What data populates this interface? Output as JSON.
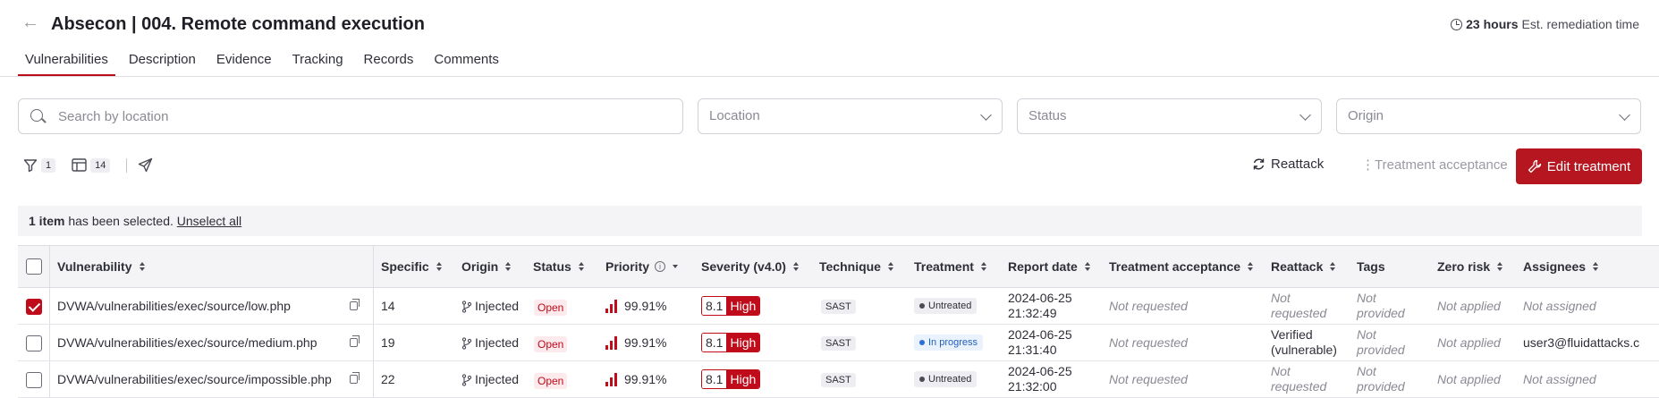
{
  "header": {
    "title": "Absecon | 004. Remote command execution",
    "remediation_hours": "23 hours",
    "remediation_label": "Est. remediation time"
  },
  "tabs": [
    "Vulnerabilities",
    "Description",
    "Evidence",
    "Tracking",
    "Records",
    "Comments"
  ],
  "filters": {
    "search_placeholder": "Search by location",
    "location": "Location",
    "status": "Status",
    "origin": "Origin"
  },
  "toolbar": {
    "filter_count": "1",
    "columns_count": "14",
    "reattack": "Reattack",
    "treatment_acceptance": "Treatment acceptance",
    "edit_treatment": "Edit treatment"
  },
  "selection": {
    "count": "1 item",
    "text": "has been selected.",
    "unselect": "Unselect all"
  },
  "columns": [
    "Vulnerability",
    "Specific",
    "Origin",
    "Status",
    "Priority",
    "Severity (v4.0)",
    "Technique",
    "Treatment",
    "Report date",
    "Treatment acceptance",
    "Reattack",
    "Tags",
    "Zero risk",
    "Assignees"
  ],
  "rows": [
    {
      "vulnerability": "DVWA/vulnerabilities/exec/source/low.php",
      "specific": "14",
      "origin": "Injected",
      "status": "Open",
      "priority": "99.91%",
      "severity_score": "8.1",
      "severity_level": "High",
      "technique": "SAST",
      "treatment": "Untreated",
      "report_date_line1": "2024-06-25",
      "report_date_line2": "21:32:49",
      "treatment_acceptance": "Not requested",
      "reattack_line1": "Not",
      "reattack_line2": "requested",
      "tags_line1": "Not",
      "tags_line2": "provided",
      "zero_risk": "Not applied",
      "assignees": "Not assigned",
      "selected": true
    },
    {
      "vulnerability": "DVWA/vulnerabilities/exec/source/medium.php",
      "specific": "19",
      "origin": "Injected",
      "status": "Open",
      "priority": "99.91%",
      "severity_score": "8.1",
      "severity_level": "High",
      "technique": "SAST",
      "treatment": "In progress",
      "report_date_line1": "2024-06-25",
      "report_date_line2": "21:31:40",
      "treatment_acceptance": "Not requested",
      "reattack_line1": "Verified",
      "reattack_line2": "(vulnerable)",
      "tags_line1": "Not",
      "tags_line2": "provided",
      "zero_risk": "Not applied",
      "assignees": "user3@fluidattacks.c",
      "selected": false
    },
    {
      "vulnerability": "DVWA/vulnerabilities/exec/source/impossible.php",
      "specific": "22",
      "origin": "Injected",
      "status": "Open",
      "priority": "99.91%",
      "severity_score": "8.1",
      "severity_level": "High",
      "technique": "SAST",
      "treatment": "Untreated",
      "report_date_line1": "2024-06-25",
      "report_date_line2": "21:32:00",
      "treatment_acceptance": "Not requested",
      "reattack_line1": "Not",
      "reattack_line2": "requested",
      "tags_line1": "Not",
      "tags_line2": "provided",
      "zero_risk": "Not applied",
      "assignees": "Not assigned",
      "selected": false
    }
  ],
  "colors": {
    "accent": "#bf0b1a",
    "button": "#b5161f"
  }
}
